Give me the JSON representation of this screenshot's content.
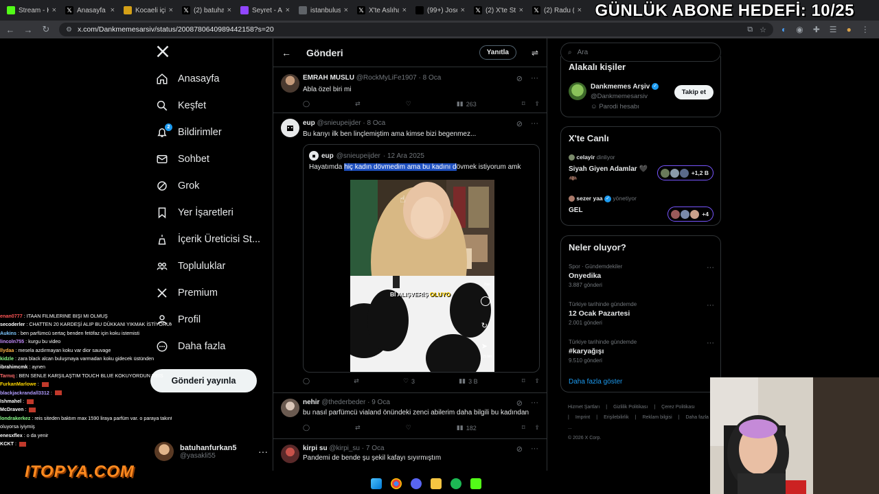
{
  "browser": {
    "tabs": [
      {
        "label": "Stream - K",
        "fav": "kick-icon",
        "color": "#53fc18"
      },
      {
        "label": "Anasayfa /",
        "fav": "x-icon",
        "color": "#000000"
      },
      {
        "label": "Kocaeli için",
        "fav": "shield-icon",
        "color": "#d4a017"
      },
      {
        "label": "(2) batuha",
        "fav": "x-icon",
        "color": "#000000"
      },
      {
        "label": "Seyret - Ar",
        "fav": "twitch-icon",
        "color": "#9146ff"
      },
      {
        "label": "istanbulusu",
        "fav": "globe-icon",
        "color": "#5f6368"
      },
      {
        "label": "X'te Aslıha",
        "fav": "x-icon",
        "color": "#000000"
      },
      {
        "label": "(99+) Josep",
        "fav": "tiktok-icon",
        "color": "#000000"
      },
      {
        "label": "(2) X'te Stu",
        "fav": "x-icon",
        "color": "#000000"
      },
      {
        "label": "(2) Radu (",
        "fav": "x-icon",
        "color": "#000000"
      }
    ],
    "url": "x.com/Dankmemesarsiv/status/2008780640989442158?s=20"
  },
  "overlay": {
    "goal_text": "GÜNLÜK ABONE HEDEFİ: 10/25",
    "sponsor": "ITOPYA.COM"
  },
  "leftnav": {
    "items": [
      {
        "label": "Anasayfa",
        "icon": "home-icon"
      },
      {
        "label": "Keşfet",
        "icon": "search-icon"
      },
      {
        "label": "Bildirimler",
        "icon": "bell-icon",
        "badge": "2"
      },
      {
        "label": "Sohbet",
        "icon": "mail-icon"
      },
      {
        "label": "Grok",
        "icon": "grok-icon"
      },
      {
        "label": "Yer İşaretleri",
        "icon": "bookmark-icon"
      },
      {
        "label": "İçerik Üreticisi St...",
        "icon": "creator-icon"
      },
      {
        "label": "Topluluklar",
        "icon": "communities-icon"
      },
      {
        "label": "Premium",
        "icon": "x-premium-icon"
      },
      {
        "label": "Profil",
        "icon": "person-icon"
      },
      {
        "label": "Daha fazla",
        "icon": "more-circle-icon"
      }
    ],
    "post_button": "Gönderi yayınla",
    "profile": {
      "name": "batuhanfurkan5",
      "handle": "@yasakli55"
    }
  },
  "chat": [
    {
      "user": "enan0777",
      "color": "#ff5555",
      "msg": "ITAAN FILMLERINE BIŞI MI OLMUŞ"
    },
    {
      "user": "secoderler",
      "color": "#ffffff",
      "msg": "CHATTEN 20 KARDEŞİ ALIP BU DÜKKANI YIKMAK İSTİYORUM"
    },
    {
      "user": "Aukins",
      "color": "#7ec8ff",
      "msg": "ben parfümcü sertaç benden fetöfaz için koku istemisti"
    },
    {
      "user": "lincoln755",
      "color": "#c58cff",
      "msg": "kurgu bu video"
    },
    {
      "user": "llydaa",
      "color": "#ffb347",
      "msg": "mesela azdırmayan koku var dior sauvage"
    },
    {
      "user": "kidzle",
      "color": "#8cff8c",
      "msg": "zara black alcan buluşmaya varmadan koku gidecek üstünden"
    },
    {
      "user": "ibrahimcmk",
      "color": "#ffffff",
      "msg": "aynen"
    },
    {
      "user": "Tarnıq",
      "color": "#ff6b6b",
      "msg": "BEN SENLE KARŞILAŞTIM TOUCH BLUE KOKUYORDUN REİS"
    },
    {
      "user": "FurkanMarlowe",
      "color": "#ffd700",
      "msg": ""
    },
    {
      "user": "blackjackrandall3312",
      "color": "#b19cff",
      "msg": ""
    },
    {
      "user": "Ishmahel",
      "color": "#ffffff",
      "msg": ""
    },
    {
      "user": "McDraven",
      "color": "#ffffff",
      "msg": ""
    },
    {
      "user": "londrakerkez",
      "color": "#8cff8c",
      "msg": "reis siteden baktım max 1590 liraya parfüm var. o paraya takıntı"
    },
    {
      "user": "",
      "color": "#ffffff",
      "msg": "oluyorsa iyiymiş"
    },
    {
      "user": "enesxflex",
      "color": "#ffffff",
      "msg": "o da yenir"
    },
    {
      "user": "KCKT",
      "color": "#ffffff",
      "msg": ""
    }
  ],
  "main": {
    "header_title": "Gönderi",
    "reply_button": "Yanıtla",
    "tweets": [
      {
        "name": "EMRAH MUSLU",
        "handle": "@RockMyLiFe1907",
        "date": "· 8 Oca",
        "text": "Abla özel biri mi",
        "views": "263",
        "likes": "",
        "replies": "",
        "retweets": ""
      },
      {
        "name": "eup",
        "handle": "@snieupeijder",
        "date": "· 8 Oca",
        "text": "Bu karıyı ilk ben linçlemiştim ama kimse bizi begenmez...",
        "quote": {
          "name": "eup",
          "handle": "@snieupeijder",
          "date": "· 12 Ara 2025",
          "text_before": "Hayatımda ",
          "text_highlight": "hiç kadın dövmedim ama bu kadını d",
          "text_after": "övmek istiyorum amk",
          "video_caption_white": "Bİ ALIŞVERİŞ",
          "video_caption_yellow": "OLUYO",
          "video_side_count_1": "2bin",
          "video_side_count_2": "15 bin"
        },
        "replies": "",
        "retweets": "",
        "likes": "3",
        "views": "3 B"
      },
      {
        "name": "nehir",
        "handle": "@thederbeder",
        "date": "· 9 Oca",
        "text": "bu nasıl parfümcü vialand önündeki zenci abilerim daha bilgili bu kadından",
        "views": "182"
      },
      {
        "name": "kirpi su",
        "handle": "@kirpi_su",
        "date": "· 7 Oca",
        "text": "Pandemi de bende şu şekil kafayı sıyırmıştım"
      }
    ]
  },
  "right": {
    "search_placeholder": "Ara",
    "related_title": "Alakalı kişiler",
    "related_person": {
      "name": "Dankmemes Arşiv",
      "handle": "@Dankmemesarsiv",
      "note": "Parodi hesabı",
      "follow": "Takip et"
    },
    "live_title": "X'te Canlı",
    "live": [
      {
        "user": "celayir",
        "status": "dinliyor",
        "title": "Siyah Giyen Adamlar 🖤",
        "title2": "🦇",
        "count": "+1,2 B"
      },
      {
        "user": "sezer yaa",
        "status": "yönetiyor",
        "title": "GEL",
        "count": "+4"
      }
    ],
    "trends_title": "Neler oluyor?",
    "trends": [
      {
        "cat": "Spor · Gündemdekiler",
        "title": "Onyedika",
        "count": "3.887 gönderi"
      },
      {
        "cat": "Türkiye tarihinde gündemde",
        "title": "12 Ocak Pazartesi",
        "count": "2.001 gönderi"
      },
      {
        "cat": "Türkiye tarihinde gündemde",
        "title": "#karyağışı",
        "count": "9.510 gönderi"
      }
    ],
    "show_more": "Daha fazla göster",
    "footer": [
      "Hizmet Şartları",
      "|",
      "Gizlilik Politikası",
      "|",
      "Çerez Politikası",
      "|",
      "Imprint",
      "|",
      "Erişilebilirlik",
      "|",
      "Reklam bilgisi",
      "|",
      "Daha fazla ...",
      "© 2026 X Corp."
    ]
  }
}
